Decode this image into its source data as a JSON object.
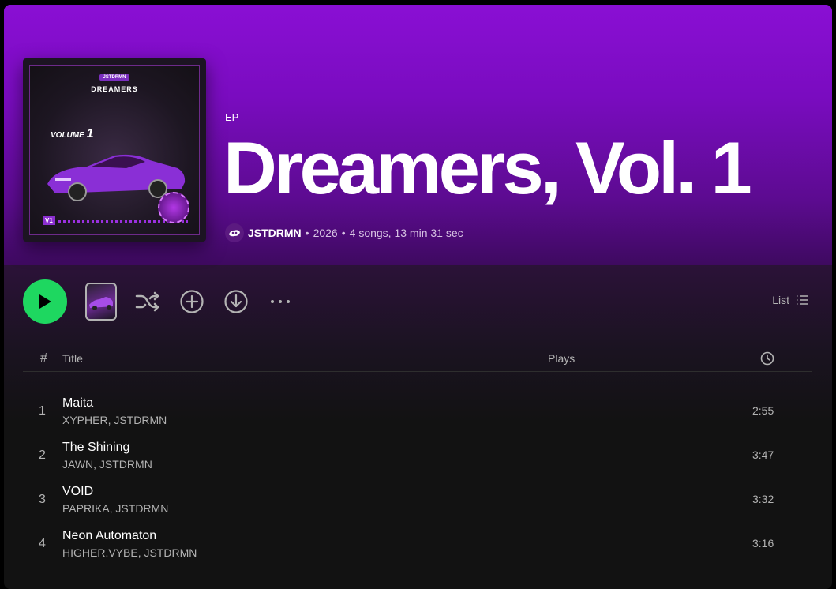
{
  "album": {
    "type_label": "EP",
    "title": "Dreamers, Vol. 1",
    "artist": "JSTDRMN",
    "year": "2026",
    "summary": "4 songs, 13 min 31 sec",
    "separator": "•"
  },
  "cover_art": {
    "brand": "JSTDRMN",
    "title": "DREAMERS",
    "volume_word": "VOLUME",
    "volume_number": "1",
    "corner_tag": "V1"
  },
  "actions": {
    "view_label": "List"
  },
  "table": {
    "headers": {
      "number": "#",
      "title": "Title",
      "plays": "Plays"
    },
    "rows": [
      {
        "number": "1",
        "title": "Maita",
        "artists": "XYPHER, JSTDRMN",
        "duration": "2:55"
      },
      {
        "number": "2",
        "title": "The Shining",
        "artists": "JAWN, JSTDRMN",
        "duration": "3:47"
      },
      {
        "number": "3",
        "title": "VOID",
        "artists": "PAPRIKA, JSTDRMN",
        "duration": "3:32"
      },
      {
        "number": "4",
        "title": "Neon Automaton",
        "artists": "HIGHER.VYBE, JSTDRMN",
        "duration": "3:16"
      }
    ]
  },
  "colors": {
    "accent_green": "#1ed760",
    "header_purple": "#8a0fd4",
    "background": "#121212"
  },
  "icons": {
    "play": "play-icon",
    "shuffle": "shuffle-icon",
    "add": "plus-circle-icon",
    "download": "download-icon",
    "more": "more-options-icon",
    "list": "list-icon",
    "duration": "clock-icon"
  }
}
